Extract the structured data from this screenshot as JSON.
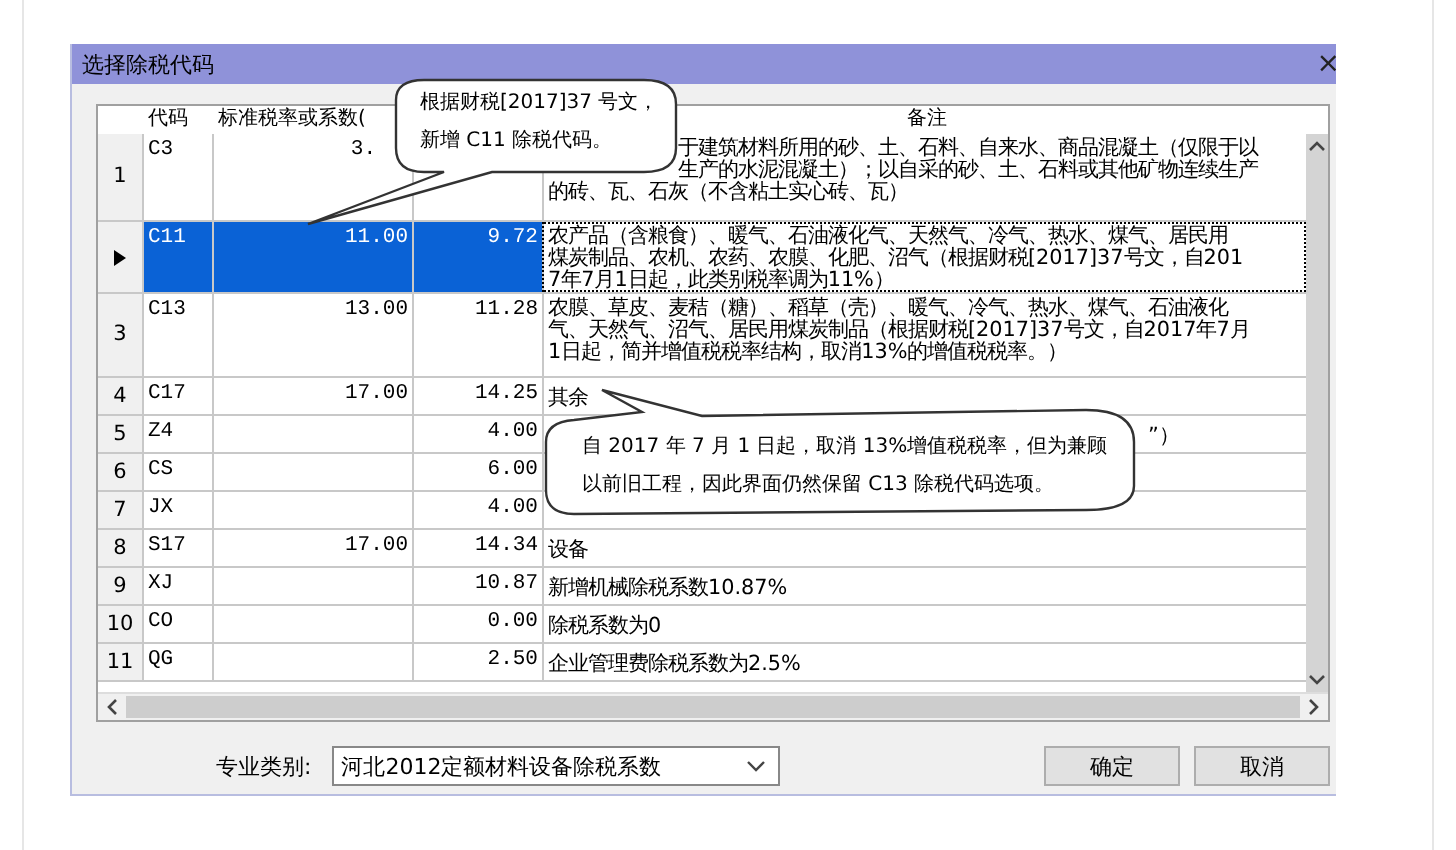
{
  "window": {
    "title": "选择除税代码",
    "close": "×"
  },
  "table": {
    "columns": [
      "代码",
      "标准税率或系数(",
      "备注"
    ],
    "rows": [
      {
        "num": "1",
        "code": "C3",
        "rate": "3.",
        "coef": "",
        "remark": [
          "于建筑材料所用的砂、土、石料、自来水、商品混凝土（仅限于以",
          "生产的水泥混凝土）；以自采的砂、土、石料或其他矿物连续生产",
          "的砖、瓦、石灰（不含粘土实心砖、瓦）"
        ],
        "selected": false
      },
      {
        "num": "",
        "code": "C11",
        "rate": "11.00",
        "coef": "9.72",
        "remark": [
          "农产品（含粮食）、暖气、石油液化气、天然气、冷气、热水、煤气、居民用",
          "煤炭制品、农机、农药、农膜、化肥、沼气（根据财税[2017]37号文，自201",
          "7年7月1日起，此类别税率调为11%）"
        ],
        "selected": true
      },
      {
        "num": "3",
        "code": "C13",
        "rate": "13.00",
        "coef": "11.28",
        "remark": [
          "农膜、草皮、麦秸（糖）、稻草（壳）、暖气、冷气、热水、煤气、石油液化",
          "气、天然气、沼气、居民用煤炭制品（根据财税[2017]37号文，自2017年7月",
          "1日起，简并增值税税率结构，取消13%的增值税税率。）"
        ],
        "selected": false
      },
      {
        "num": "4",
        "code": "C17",
        "rate": "17.00",
        "coef": "14.25",
        "remark": [
          "其余"
        ],
        "selected": false
      },
      {
        "num": "5",
        "code": "Z4",
        "rate": "",
        "coef": "4.00",
        "remark": [
          "”）"
        ],
        "selected": false
      },
      {
        "num": "6",
        "code": "CS",
        "rate": "",
        "coef": "6.00",
        "remark": [],
        "selected": false
      },
      {
        "num": "7",
        "code": "JX",
        "rate": "",
        "coef": "4.00",
        "remark": [],
        "selected": false
      },
      {
        "num": "8",
        "code": "S17",
        "rate": "17.00",
        "coef": "14.34",
        "remark": [
          "设备"
        ],
        "selected": false
      },
      {
        "num": "9",
        "code": "XJ",
        "rate": "",
        "coef": "10.87",
        "remark": [
          "新增机械除税系数10.87%"
        ],
        "selected": false
      },
      {
        "num": "10",
        "code": "CO",
        "rate": "",
        "coef": "0.00",
        "remark": [
          "除税系数为0"
        ],
        "selected": false
      },
      {
        "num": "11",
        "code": "QG",
        "rate": "",
        "coef": "2.50",
        "remark": [
          "企业管理费除税系数为2.5%"
        ],
        "selected": false
      }
    ]
  },
  "callouts": [
    {
      "lines": [
        "根据财税[2017]37 号文，",
        "新增 C11 除税代码。"
      ]
    },
    {
      "lines": [
        "自 2017 年 7 月 1 日起，取消 13%增值税税率，但为兼顾",
        "以前旧工程，因此界面仍然保留 C13 除税代码选项。"
      ]
    }
  ],
  "category": {
    "label": "专业类别:",
    "value": "河北2012定额材料设备除税系数"
  },
  "buttons": [
    "确定",
    "取消"
  ]
}
